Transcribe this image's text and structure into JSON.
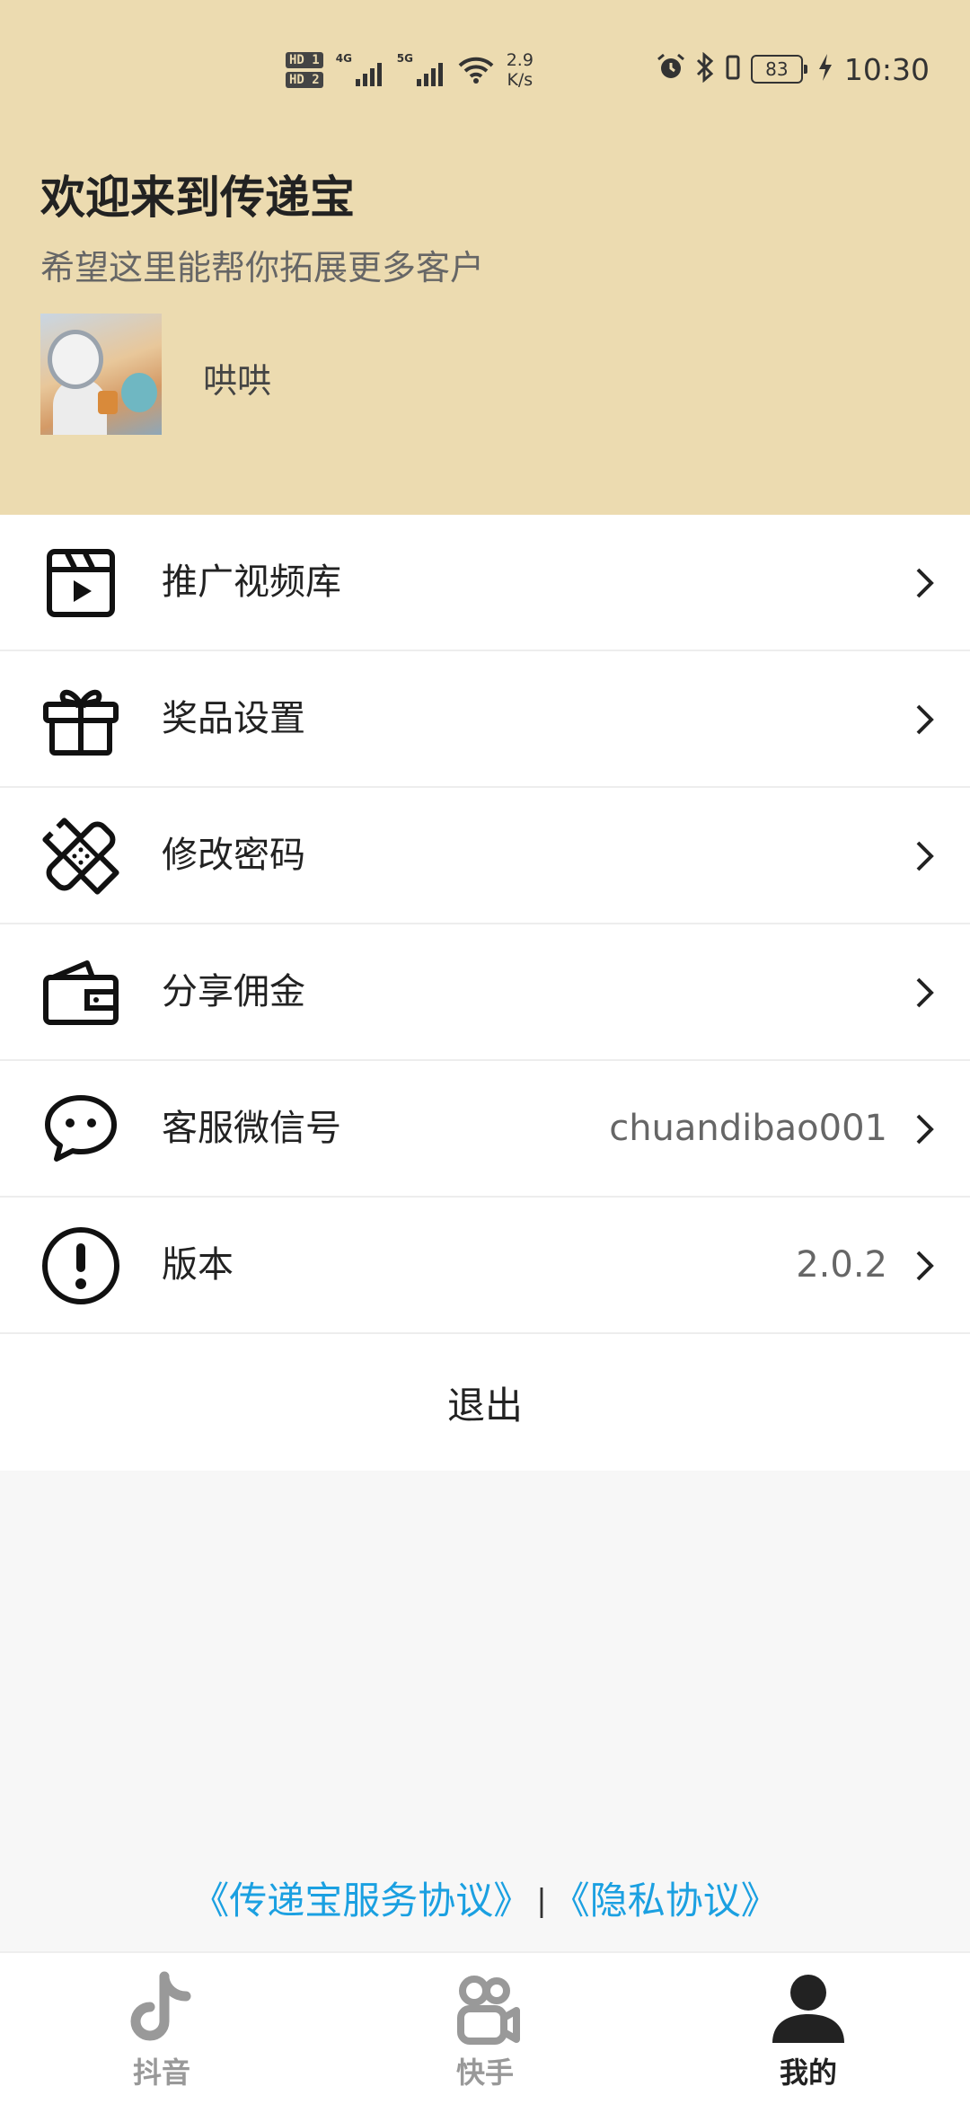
{
  "status_bar": {
    "hd1": "HD 1",
    "hd2": "HD 2",
    "gen1": "4G",
    "gen2": "5G",
    "speed_value": "2.9",
    "speed_unit": "K/s",
    "battery": "83",
    "time": "10:30"
  },
  "header": {
    "title": "欢迎来到传递宝",
    "subtitle": "希望这里能帮你拓展更多客户",
    "username": "哄哄"
  },
  "menu": {
    "items": [
      {
        "label": "推广视频库",
        "icon": "video-library-icon",
        "value": ""
      },
      {
        "label": "奖品设置",
        "icon": "gift-icon",
        "value": ""
      },
      {
        "label": "修改密码",
        "icon": "bandage-icon",
        "value": ""
      },
      {
        "label": "分享佣金",
        "icon": "wallet-icon",
        "value": ""
      },
      {
        "label": "客服微信号",
        "icon": "chat-bubble-icon",
        "value": "chuandibao001"
      },
      {
        "label": "版本",
        "icon": "exclamation-circle-icon",
        "value": "2.0.2"
      }
    ],
    "logout": "退出"
  },
  "agreements": {
    "service": "《传递宝服务协议》",
    "separator": "|",
    "privacy": "《隐私协议》"
  },
  "tabbar": {
    "tabs": [
      {
        "label": "抖音",
        "icon": "douyin-icon",
        "active": false
      },
      {
        "label": "快手",
        "icon": "kuaishou-icon",
        "active": false
      },
      {
        "label": "我的",
        "icon": "profile-icon",
        "active": true
      }
    ]
  },
  "colors": {
    "header_bg": "#ecdbb0",
    "link": "#1ba0e1",
    "page_bg": "#f7f7f7",
    "active_tab": "#222222",
    "inactive_tab": "#999999"
  }
}
